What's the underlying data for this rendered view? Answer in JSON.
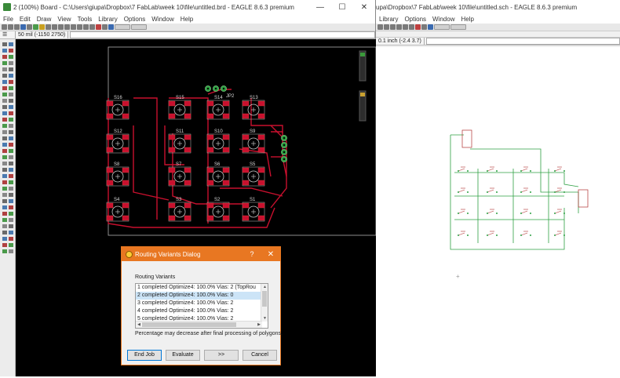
{
  "board": {
    "title": "2 (100%) Board - C:\\Users\\giupa\\Dropbox\\7 FabLab\\week 10\\file\\untitled.brd - EAGLE 8.6.3 premium",
    "menu": [
      "File",
      "Edit",
      "Draw",
      "View",
      "Tools",
      "Library",
      "Options",
      "Window",
      "Help"
    ],
    "coord": "50 mil (-1150 2750)",
    "switch_labels": [
      "S16",
      "S15",
      "S14",
      "S13",
      "S12",
      "S11",
      "S10",
      "S9",
      "S8",
      "S7",
      "S6",
      "S5",
      "S4",
      "S3",
      "S2",
      "S1"
    ],
    "header_label": "JP2"
  },
  "schematic": {
    "title": "upa\\Dropbox\\7 FabLab\\week 10\\file\\untitled.sch - EAGLE 8.6.3 premium",
    "menu": [
      "Library",
      "Options",
      "Window",
      "Help"
    ],
    "coord": "0.1 inch (-2.4 3.7)"
  },
  "dialog": {
    "title": "Routing Variants Dialog",
    "help": "?",
    "close": "✕",
    "list_label": "Routing Variants",
    "variants": [
      "1 completed Optimize4:  100.0%  Vias: 2 (TopRou",
      "2 completed Optimize4:  100.0%  Vias: 0",
      "3 completed Optimize4:  100.0%  Vias: 2",
      "4 completed Optimize4:  100.0%  Vias: 2",
      "5 completed Optimize4:  100.0%  Vias: 2"
    ],
    "selected_index": 1,
    "note": "Percentage may decrease after final processing of polygons.",
    "buttons": {
      "end_job": "End Job",
      "evaluate": "Evaluate",
      "next": ">>",
      "cancel": "Cancel"
    }
  }
}
